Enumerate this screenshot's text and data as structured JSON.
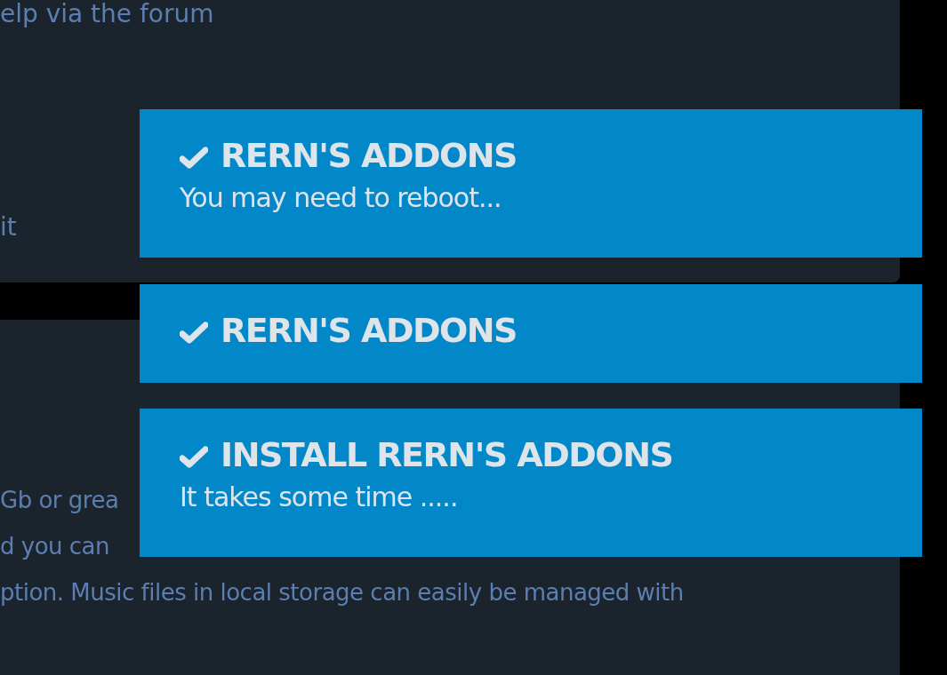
{
  "background_panels": [
    {
      "lines": [
        "elp via the forum",
        "it"
      ]
    },
    {
      "lines": [
        "Gb or grea",
        "d you can",
        "ption. Music files in local storage can easily be managed with"
      ]
    }
  ],
  "notifications": [
    {
      "title": "RERN'S ADDONS",
      "message": "You may need to reboot..."
    },
    {
      "title": "RERN'S ADDONS"
    },
    {
      "title": "INSTALL RERN'S ADDONS",
      "message": "It takes some time ....."
    }
  ]
}
